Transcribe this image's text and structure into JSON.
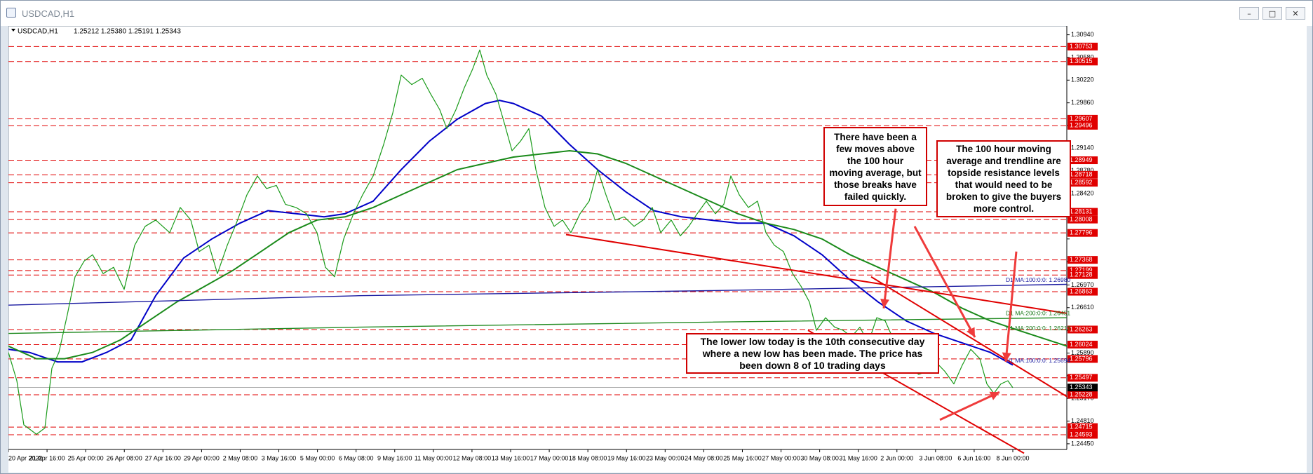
{
  "window": {
    "title": "USDCAD,H1",
    "buttons": [
      "–",
      "□",
      "✕"
    ]
  },
  "chart_header": {
    "symbol": "USDCAD,H1",
    "ohlc": "1.25212 1.25380 1.25191 1.25343"
  },
  "chart_data": {
    "type": "line",
    "symbol": "USDCAD",
    "timeframe": "H1",
    "ylim": [
      1.2436,
      1.3108
    ],
    "y_ticks": [
      1.3094,
      1.3058,
      1.3022,
      1.2986,
      1.295,
      1.2914,
      1.2878,
      1.2842,
      1.2806,
      1.277,
      1.2734,
      1.2697,
      1.2661,
      1.2625,
      1.2589,
      1.2553,
      1.2517,
      1.2481,
      1.2445
    ],
    "y_tick_labels": [
      "1.30940",
      "1.30580",
      "1.30220",
      "1.29860",
      "1.29500",
      "1.29140",
      "1.28780",
      "1.28420",
      "",
      "",
      "",
      "1.26970",
      "1.26610",
      "",
      "1.25890",
      "",
      "1.25170",
      "1.24810",
      "1.24450"
    ],
    "x_labels": [
      "20 Apr 2022",
      "21 Apr 16:00",
      "25 Apr 00:00",
      "26 Apr 08:00",
      "27 Apr 16:00",
      "29 Apr 00:00",
      "2 May 08:00",
      "3 May 16:00",
      "5 May 00:00",
      "6 May 08:00",
      "9 May 16:00",
      "11 May 00:00",
      "12 May 08:00",
      "13 May 16:00",
      "17 May 00:00",
      "18 May 08:00",
      "19 May 16:00",
      "23 May 00:00",
      "24 May 08:00",
      "25 May 16:00",
      "27 May 00:00",
      "30 May 08:00",
      "31 May 16:00",
      "2 Jun 00:00",
      "3 Jun 08:00",
      "6 Jun 16:00",
      "8 Jun 00:00"
    ],
    "price_path": [
      [
        0,
        1.259
      ],
      [
        12,
        1.2545
      ],
      [
        22,
        1.2475
      ],
      [
        40,
        1.246
      ],
      [
        52,
        1.247
      ],
      [
        62,
        1.2565
      ],
      [
        72,
        1.259
      ],
      [
        84,
        1.265
      ],
      [
        95,
        1.271
      ],
      [
        108,
        1.2735
      ],
      [
        120,
        1.2745
      ],
      [
        135,
        1.2715
      ],
      [
        150,
        1.2725
      ],
      [
        165,
        1.269
      ],
      [
        180,
        1.276
      ],
      [
        195,
        1.279
      ],
      [
        210,
        1.28
      ],
      [
        230,
        1.278
      ],
      [
        245,
        1.282
      ],
      [
        260,
        1.28
      ],
      [
        272,
        1.275
      ],
      [
        286,
        1.276
      ],
      [
        298,
        1.2715
      ],
      [
        312,
        1.276
      ],
      [
        325,
        1.2795
      ],
      [
        340,
        1.284
      ],
      [
        355,
        1.287
      ],
      [
        368,
        1.285
      ],
      [
        382,
        1.2855
      ],
      [
        395,
        1.2825
      ],
      [
        410,
        1.282
      ],
      [
        425,
        1.281
      ],
      [
        440,
        1.278
      ],
      [
        452,
        1.2725
      ],
      [
        465,
        1.271
      ],
      [
        478,
        1.277
      ],
      [
        492,
        1.281
      ],
      [
        505,
        1.284
      ],
      [
        520,
        1.287
      ],
      [
        535,
        1.292
      ],
      [
        548,
        1.297
      ],
      [
        560,
        1.303
      ],
      [
        575,
        1.3015
      ],
      [
        590,
        1.3025
      ],
      [
        602,
        1.3
      ],
      [
        615,
        1.2975
      ],
      [
        625,
        1.2945
      ],
      [
        638,
        1.2975
      ],
      [
        650,
        1.301
      ],
      [
        662,
        1.304
      ],
      [
        672,
        1.307
      ],
      [
        682,
        1.303
      ],
      [
        695,
        1.3
      ],
      [
        708,
        1.295
      ],
      [
        718,
        1.291
      ],
      [
        730,
        1.2925
      ],
      [
        742,
        1.2945
      ],
      [
        752,
        1.288
      ],
      [
        765,
        1.282
      ],
      [
        778,
        1.279
      ],
      [
        790,
        1.28
      ],
      [
        802,
        1.278
      ],
      [
        815,
        1.281
      ],
      [
        828,
        1.283
      ],
      [
        840,
        1.288
      ],
      [
        852,
        1.284
      ],
      [
        865,
        1.28
      ],
      [
        878,
        1.2805
      ],
      [
        892,
        1.279
      ],
      [
        905,
        1.28
      ],
      [
        918,
        1.282
      ],
      [
        930,
        1.278
      ],
      [
        945,
        1.28
      ],
      [
        958,
        1.2775
      ],
      [
        970,
        1.279
      ],
      [
        982,
        1.281
      ],
      [
        995,
        1.283
      ],
      [
        1008,
        1.281
      ],
      [
        1020,
        1.2825
      ],
      [
        1030,
        1.287
      ],
      [
        1042,
        1.284
      ],
      [
        1055,
        1.282
      ],
      [
        1068,
        1.283
      ],
      [
        1080,
        1.278
      ],
      [
        1092,
        1.276
      ],
      [
        1105,
        1.275
      ],
      [
        1118,
        1.2715
      ],
      [
        1130,
        1.2695
      ],
      [
        1142,
        1.267
      ],
      [
        1152,
        1.2625
      ],
      [
        1165,
        1.2645
      ],
      [
        1178,
        1.263
      ],
      [
        1190,
        1.2625
      ],
      [
        1202,
        1.2615
      ],
      [
        1214,
        1.263
      ],
      [
        1226,
        1.2605
      ],
      [
        1238,
        1.2645
      ],
      [
        1250,
        1.264
      ],
      [
        1262,
        1.261
      ],
      [
        1272,
        1.256
      ],
      [
        1285,
        1.2565
      ],
      [
        1298,
        1.2555
      ],
      [
        1310,
        1.256
      ],
      [
        1322,
        1.2575
      ],
      [
        1335,
        1.256
      ],
      [
        1348,
        1.254
      ],
      [
        1360,
        1.257
      ],
      [
        1372,
        1.2595
      ],
      [
        1385,
        1.258
      ],
      [
        1395,
        1.254
      ],
      [
        1405,
        1.2525
      ],
      [
        1415,
        1.254
      ],
      [
        1425,
        1.2545
      ],
      [
        1432,
        1.2534
      ]
    ],
    "series": [
      {
        "name": "",
        "color": "#0000c8",
        "points": [
          [
            0,
            1.2595
          ],
          [
            30,
            1.259
          ],
          [
            70,
            1.2575
          ],
          [
            105,
            1.2575
          ],
          [
            140,
            1.259
          ],
          [
            175,
            1.261
          ],
          [
            210,
            1.268
          ],
          [
            250,
            1.274
          ],
          [
            290,
            1.277
          ],
          [
            330,
            1.2795
          ],
          [
            370,
            1.2815
          ],
          [
            410,
            1.281
          ],
          [
            450,
            1.2805
          ],
          [
            480,
            1.281
          ],
          [
            520,
            1.283
          ],
          [
            560,
            1.288
          ],
          [
            600,
            1.2925
          ],
          [
            640,
            1.296
          ],
          [
            680,
            1.2985
          ],
          [
            700,
            1.299
          ],
          [
            720,
            1.2985
          ],
          [
            760,
            1.2965
          ],
          [
            800,
            1.292
          ],
          [
            840,
            1.288
          ],
          [
            880,
            1.2845
          ],
          [
            920,
            1.2815
          ],
          [
            960,
            1.2805
          ],
          [
            1000,
            1.28
          ],
          [
            1040,
            1.2795
          ],
          [
            1080,
            1.2795
          ],
          [
            1120,
            1.2775
          ],
          [
            1160,
            1.2745
          ],
          [
            1200,
            1.2705
          ],
          [
            1240,
            1.267
          ],
          [
            1280,
            1.264
          ],
          [
            1320,
            1.262
          ],
          [
            1360,
            1.2605
          ],
          [
            1400,
            1.259
          ],
          [
            1432,
            1.257
          ]
        ]
      },
      {
        "name": "",
        "color": "#1a8a1a",
        "points": [
          [
            0,
            1.26
          ],
          [
            40,
            1.258
          ],
          [
            80,
            1.258
          ],
          [
            120,
            1.259
          ],
          [
            160,
            1.261
          ],
          [
            200,
            1.264
          ],
          [
            240,
            1.267
          ],
          [
            280,
            1.2695
          ],
          [
            320,
            1.272
          ],
          [
            360,
            1.275
          ],
          [
            400,
            1.278
          ],
          [
            440,
            1.28
          ],
          [
            480,
            1.2805
          ],
          [
            520,
            1.282
          ],
          [
            560,
            1.284
          ],
          [
            600,
            1.286
          ],
          [
            640,
            1.288
          ],
          [
            680,
            1.289
          ],
          [
            720,
            1.29
          ],
          [
            760,
            1.2905
          ],
          [
            800,
            1.291
          ],
          [
            840,
            1.2905
          ],
          [
            880,
            1.289
          ],
          [
            920,
            1.287
          ],
          [
            960,
            1.285
          ],
          [
            1000,
            1.283
          ],
          [
            1040,
            1.281
          ],
          [
            1080,
            1.2795
          ],
          [
            1120,
            1.2785
          ],
          [
            1160,
            1.277
          ],
          [
            1200,
            1.2745
          ],
          [
            1240,
            1.2725
          ],
          [
            1280,
            1.2705
          ],
          [
            1320,
            1.2685
          ],
          [
            1360,
            1.266
          ],
          [
            1400,
            1.264
          ],
          [
            1440,
            1.2625
          ],
          [
            1509,
            1.26
          ]
        ]
      },
      {
        "name": "",
        "color": "#1a1aa0",
        "points": [
          [
            0,
            1.2665
          ],
          [
            500,
            1.268
          ],
          [
            1000,
            1.2688
          ],
          [
            1509,
            1.2698
          ]
        ]
      },
      {
        "name": "",
        "color": "#228b22",
        "points": [
          [
            0,
            1.262
          ],
          [
            500,
            1.263
          ],
          [
            1000,
            1.2638
          ],
          [
            1509,
            1.2645
          ]
        ]
      }
    ],
    "trendlines": [
      {
        "color": "#e00000",
        "points": [
          [
            795,
            1.2777
          ],
          [
            1509,
            1.2652
          ]
        ]
      },
      {
        "color": "#e00000",
        "points": [
          [
            1140,
            1.2625
          ],
          [
            1448,
            1.243
          ]
        ]
      },
      {
        "color": "#e00000",
        "points": [
          [
            1230,
            1.271
          ],
          [
            1509,
            1.252
          ]
        ]
      }
    ],
    "horizontal_levels": [
      {
        "value": 1.30753,
        "label": "1.30753"
      },
      {
        "value": 1.30515,
        "label": "1.30515"
      },
      {
        "value": 1.29607,
        "label": "1.29607"
      },
      {
        "value": 1.29496,
        "label": "1.29496"
      },
      {
        "value": 1.28949,
        "label": "1.28949"
      },
      {
        "value": 1.28718,
        "label": "1.28718"
      },
      {
        "value": 1.28592,
        "label": "1.28592"
      },
      {
        "value": 1.28131,
        "label": "1.28131"
      },
      {
        "value": 1.28008,
        "label": "1.28008"
      },
      {
        "value": 1.27796,
        "label": "1.27796"
      },
      {
        "value": 1.27368,
        "label": "1.27368"
      },
      {
        "value": 1.27199,
        "label": "1.27199"
      },
      {
        "value": 1.27128,
        "label": "1.27128"
      },
      {
        "value": 1.26863,
        "label": "1.26863"
      },
      {
        "value": 1.26263,
        "label": "1.26263"
      },
      {
        "value": 1.26024,
        "label": "1.26024"
      },
      {
        "value": 1.25796,
        "label": "1.25796"
      },
      {
        "value": 1.25497,
        "label": "1.25497"
      },
      {
        "value": 1.25228,
        "label": "1.25228"
      },
      {
        "value": 1.24715,
        "label": "1.24715"
      },
      {
        "value": 1.24593,
        "label": "1.24593"
      }
    ],
    "current_price": {
      "value": 1.25343,
      "label": "1.25343"
    },
    "ma_labels": [
      {
        "text": "D1 MA:100:0:0: 1.26980",
        "value": 1.2698
      },
      {
        "text": "D1 MA:200:0:0: 1.26451",
        "value": 1.2645
      },
      {
        "text": "H1 MA:200:0:0: 1.26213",
        "value": 1.2621
      },
      {
        "text": "H1 MA:100:0:0: 1.25694",
        "value": 1.257
      }
    ],
    "annotations": [
      "There have been a few moves above the 100 hour moving average, but those breaks have failed quickly.",
      "The 100 hour moving average and trendline are topside resistance levels that would need to be broken to give the buyers more control.",
      "The lower low today is the 10th consecutive day where a new low has been made. The price has been down 8 of 10 trading days"
    ],
    "arrows": [
      {
        "from": [
          1265,
          1.2818
        ],
        "to": [
          1248,
          1.266
        ]
      },
      {
        "from": [
          1292,
          1.279
        ],
        "to": [
          1378,
          1.2614
        ]
      },
      {
        "from": [
          1437,
          1.275
        ],
        "to": [
          1422,
          1.2575
        ]
      },
      {
        "from": [
          1328,
          1.2483
        ],
        "to": [
          1413,
          1.2527
        ]
      }
    ],
    "grid": false,
    "legend": "none"
  },
  "colors": {
    "chart_bg": "#ffffff",
    "price": "#1a9b1a",
    "sr_line": "#e00000",
    "callout_border": "#d00000"
  }
}
